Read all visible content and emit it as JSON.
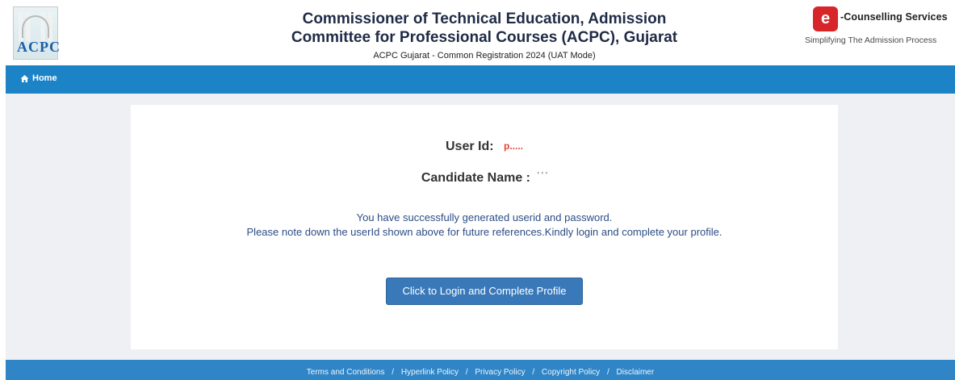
{
  "header": {
    "logo_left_text": "ACPC",
    "title_line1": "Commissioner of Technical Education, Admission",
    "title_line2": "Committee for Professional Courses (ACPC), Gujarat",
    "subtitle": "ACPC Gujarat - Common Registration 2024 (UAT Mode)",
    "logo_right": {
      "icon_letter": "e",
      "name": "-Counselling Services",
      "tagline": "Simplifying The Admission Process"
    }
  },
  "nav": {
    "home_label": "Home"
  },
  "main": {
    "user_id_label": "User Id:",
    "user_id_value": "p.....",
    "candidate_name_label": "Candidate Name :",
    "candidate_name_value": "' ' '",
    "message_line1": "You have successfully generated userid and password.",
    "message_line2": "Please note down the userId shown above for future references.Kindly login and complete your profile.",
    "button_label": "Click to Login and Complete Profile"
  },
  "footer": {
    "links": [
      "Terms and Conditions",
      "Hyperlink Policy",
      "Privacy Policy",
      "Copyright Policy",
      "Disclaimer"
    ],
    "separator": "/"
  },
  "colors": {
    "nav_blue": "#1c84c6",
    "footer_blue": "#2f85c6",
    "button_blue": "#3a79b9",
    "message_blue": "#2c4d86",
    "brand_red": "#d72629"
  }
}
